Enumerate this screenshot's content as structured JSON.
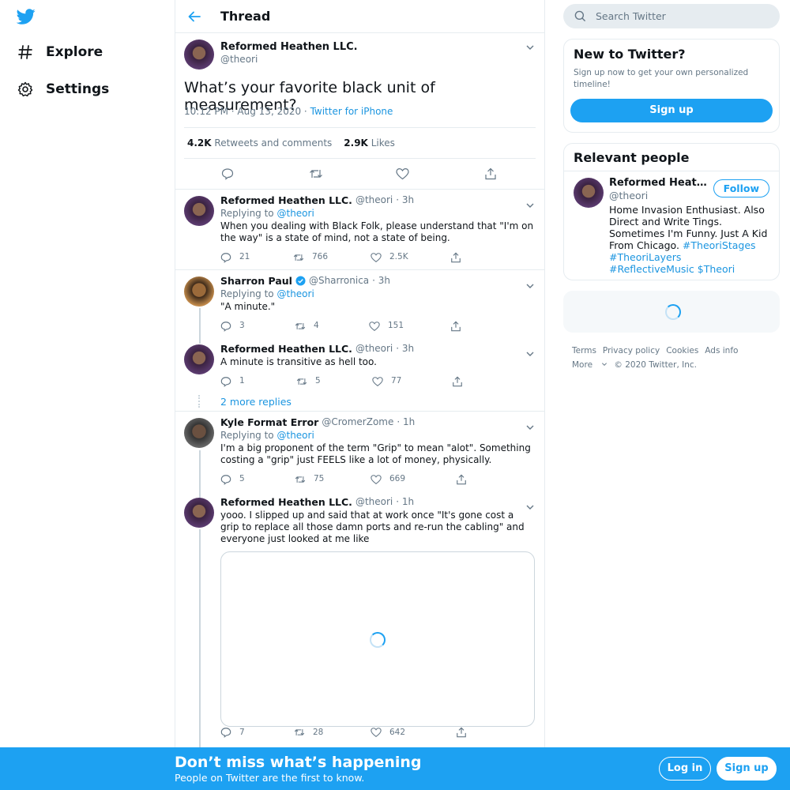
{
  "nav": {
    "explore": "Explore",
    "settings": "Settings"
  },
  "header": {
    "title": "Thread"
  },
  "focal": {
    "name": "Reformed Heathen LLC.",
    "handle": "@theori",
    "text": "What’s your favorite black unit of measurement?",
    "time": "10:12 PM · Aug 13, 2020 · ",
    "source": "Twitter for iPhone",
    "retweets_count": "4.2K",
    "retweets_label": "Retweets and comments",
    "likes_count": "2.9K",
    "likes_label": "Likes"
  },
  "replies": [
    {
      "name": "Reformed Heathen LLC.",
      "handle": "@theori",
      "time": "· 3h",
      "replying": "Replying to",
      "replying_to": "@theori",
      "text": "When you dealing with Black Folk, please understand that \"I'm on the way\" is a state of mind, not a state of being.",
      "replies": "21",
      "retweets": "766",
      "likes": "2.5K"
    },
    {
      "name": "Sharron Paul",
      "handle": "@Sharronica",
      "time": "· 3h",
      "replying": "Replying to",
      "replying_to": "@theori",
      "text": "\"A minute.\"",
      "replies": "3",
      "retweets": "4",
      "likes": "151"
    },
    {
      "name": "Reformed Heathen LLC.",
      "handle": "@theori",
      "time": "· 3h",
      "text": "A minute is transitive as hell too.",
      "replies": "1",
      "retweets": "5",
      "likes": "77"
    },
    {
      "name": "Kyle Format Error",
      "handle": "@CromerZome",
      "time": "· 1h",
      "replying": "Replying to",
      "replying_to": "@theori",
      "text": "I'm a big proponent of the term \"Grip\" to mean \"alot\". Something costing a \"grip\" just FEELS like a lot of money, physically.",
      "replies": "5",
      "retweets": "75",
      "likes": "669"
    },
    {
      "name": "Reformed Heathen LLC.",
      "handle": "@theori",
      "time": "· 1h",
      "text": "yooo. I slipped up and said that at work once \"It's gone cost a grip to replace all those damn ports and re-run the cabling\" and everyone just looked at me like",
      "replies": "7",
      "retweets": "28",
      "likes": "642"
    }
  ],
  "more_replies": "2 more replies",
  "search": {
    "placeholder": "Search Twitter"
  },
  "new_to_twitter": {
    "title": "New to Twitter?",
    "subtitle": "Sign up now to get your own personalized timeline!",
    "signup": "Sign up"
  },
  "relevant": {
    "title": "Relevant people",
    "name": "Reformed Heathen LLC.",
    "handle": "@theori",
    "follow": "Follow",
    "bio_text": "Home Invasion Enthusiast. Also Direct and Write Tings. Sometimes I'm Funny. Just A Kid From Chicago. ",
    "bio_tag1": "#TheoriStages",
    "bio_tag2": "#TheoriLayers",
    "bio_tag3": "#ReflectiveMusic",
    "bio_tag4": "$Theori"
  },
  "footer": {
    "terms": "Terms",
    "privacy": "Privacy policy",
    "cookies": "Cookies",
    "ads": "Ads info",
    "more": "More",
    "copyright": "© 2020 Twitter, Inc."
  },
  "bottom_bar": {
    "headline": "Don’t miss what’s happening",
    "sub": "People on Twitter are the first to know.",
    "login": "Log in",
    "signup": "Sign up"
  },
  "colors": {
    "brand": "#1da1f2",
    "link": "#1b95e0",
    "muted": "#657786",
    "border": "#e6ecf0"
  },
  "icons": [
    "twitter-bird-icon",
    "hashtag-icon",
    "gear-icon",
    "back-arrow-icon",
    "chevron-down-icon",
    "reply-icon",
    "retweet-icon",
    "like-icon",
    "share-icon",
    "search-icon",
    "verified-icon",
    "loading-spinner"
  ]
}
